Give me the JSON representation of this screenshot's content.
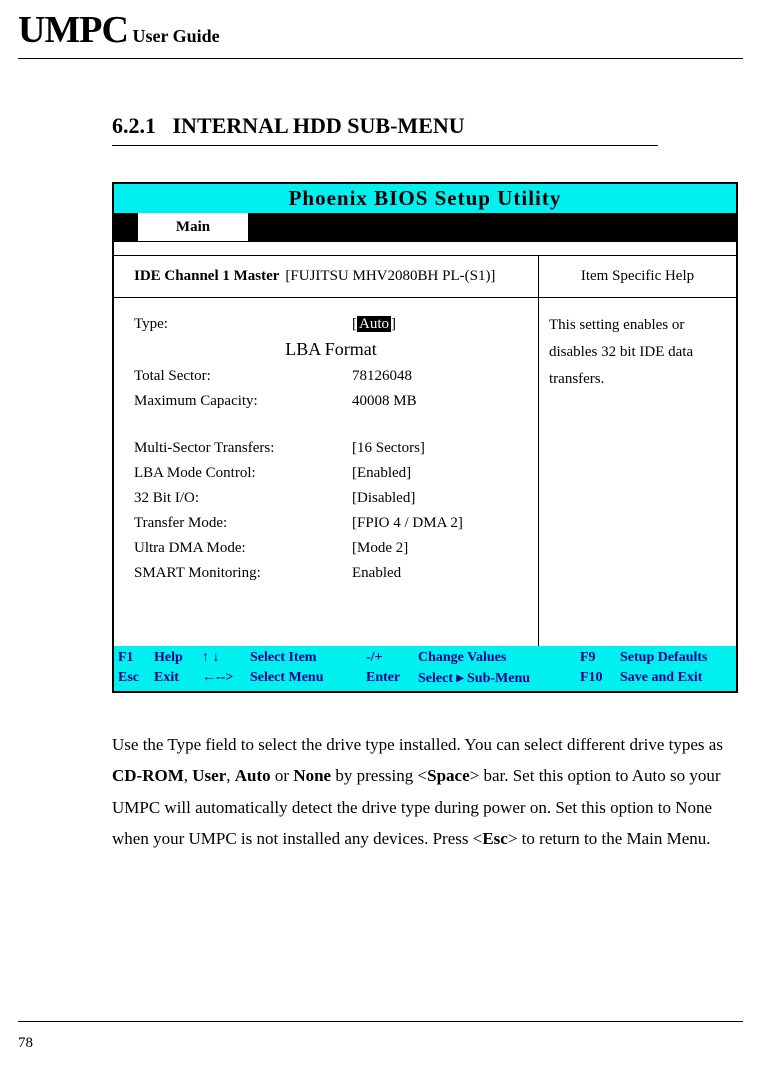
{
  "header": {
    "big": "UMPC",
    "small": " User Guide"
  },
  "section": {
    "number": "6.2.1",
    "title": "INTERNAL HDD SUB-MENU"
  },
  "bios": {
    "title": "Phoenix BIOS Setup Utility",
    "tab": "Main",
    "heading_label": "IDE Channel 1 Master",
    "heading_value": "[FUJITSU MHV2080BH PL-(S1)]",
    "help_heading": "Item Specific Help",
    "rows": {
      "type_label": "Type:",
      "type_value": "Auto",
      "lba_format": "LBA Format",
      "total_sector_label": "Total Sector:",
      "total_sector_value": "78126048",
      "max_capacity_label": "Maximum Capacity:",
      "max_capacity_value": "40008 MB",
      "multi_sector_label": "Multi-Sector Transfers:",
      "multi_sector_value": "[16 Sectors]",
      "lba_mode_label": "LBA Mode Control:",
      "lba_mode_value": "[Enabled]",
      "bit32_label": "32 Bit I/O:",
      "bit32_value": "[Disabled]",
      "transfer_mode_label": "Transfer Mode:",
      "transfer_mode_value": "[FPIO 4 / DMA 2]",
      "ultra_dma_label": "Ultra DMA Mode:",
      "ultra_dma_value": "[Mode 2]",
      "smart_label": "SMART Monitoring:",
      "smart_value": "Enabled"
    },
    "help_text": "This setting enables or disables 32 bit IDE data transfers.",
    "footer": {
      "row1": {
        "k1": "F1",
        "a1": "Help",
        "arr": "↑ ↓",
        "sel": "Select Item",
        "k2": "-/+",
        "a2": "Change Values",
        "k3": "F9",
        "a3": "Setup Defaults"
      },
      "row2": {
        "k1": "Esc",
        "a1": "Exit",
        "arr": "←-->",
        "sel": "Select Menu",
        "k2": "Enter",
        "a2": "Select ▸ Sub-Menu",
        "k3": "F10",
        "a3": "Save and Exit"
      }
    }
  },
  "paragraph": {
    "p1": "Use the Type field to select the drive type installed. You can select different drive types as ",
    "b1": "CD-ROM",
    "c1": ", ",
    "b2": "User",
    "c2": ", ",
    "b3": "Auto",
    "c3": " or ",
    "b4": "None",
    "c4": " by pressing <",
    "b5": "Space",
    "c5": "> bar. Set this option to Auto so your UMPC will automatically detect the drive type during power on. Set this option to None when your UMPC is not installed any devices. Press <",
    "b6": "Esc",
    "c6": "> to return to the Main Menu."
  },
  "page_number": "78"
}
